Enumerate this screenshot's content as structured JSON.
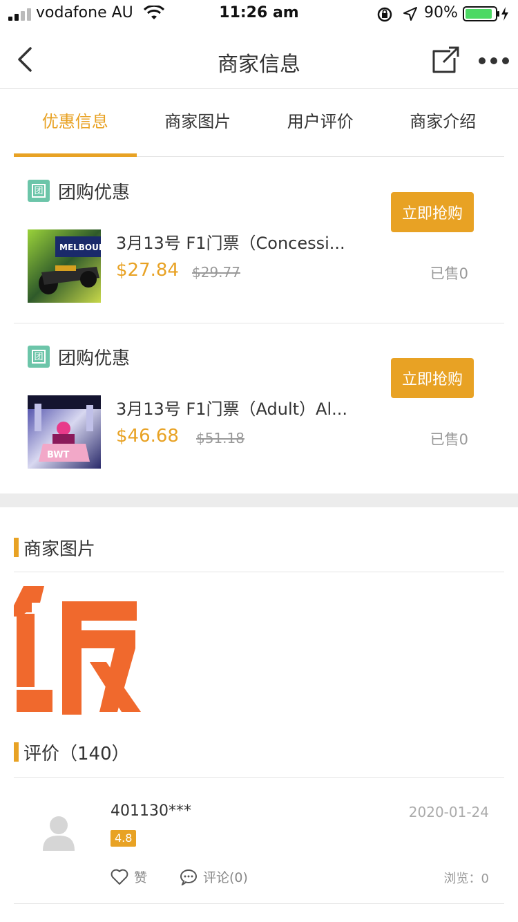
{
  "status_bar": {
    "carrier": "vodafone AU",
    "time": "11:26 am",
    "battery_percent": "90%",
    "battery_level": 0.9
  },
  "nav": {
    "title": "商家信息",
    "back_icon": "chevron-left-icon",
    "share_icon": "share-icon",
    "more_icon": "more-dots-icon"
  },
  "tabs": [
    {
      "label": "优惠信息",
      "active": true
    },
    {
      "label": "商家图片",
      "active": false
    },
    {
      "label": "用户评价",
      "active": false
    },
    {
      "label": "商家介绍",
      "active": false
    }
  ],
  "deals": [
    {
      "icon_char": "团",
      "type": "团购优惠",
      "title": "3月13号 F1门票（Concessi...",
      "price": "$27.84",
      "original_price": "$29.77",
      "button": "立即抢购",
      "sold": "已售0"
    },
    {
      "icon_char": "团",
      "type": "团购优惠",
      "title": "3月13号 F1门票（Adult）Al...",
      "price": "$46.68",
      "original_price": "$51.18",
      "button": "立即抢购",
      "sold": "已售0"
    }
  ],
  "photos_section": {
    "title": "商家图片",
    "logo_char": "饭"
  },
  "reviews_section": {
    "title": "评价（140）",
    "reviews": [
      {
        "user": "401130***",
        "date": "2020-01-24",
        "score": "4.8",
        "like_label": "赞",
        "comment_label": "评论(0)",
        "views": "浏览：0"
      }
    ]
  },
  "colors": {
    "accent": "#e8a224",
    "tuan_icon": "#6cc5a9",
    "logo": "#f0692d",
    "battery": "#4cd964"
  }
}
